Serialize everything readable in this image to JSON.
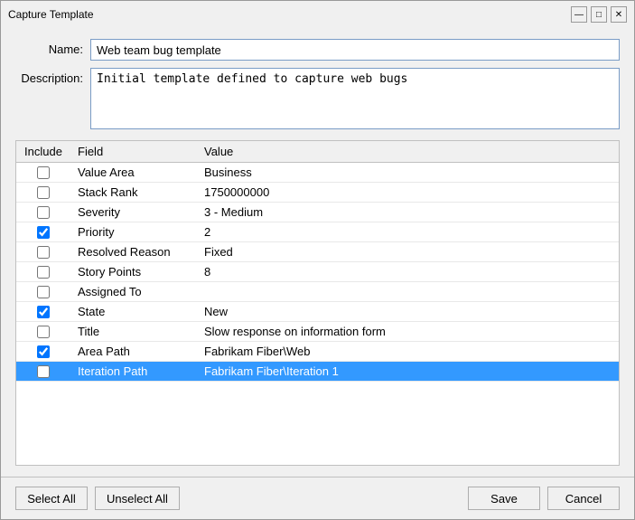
{
  "window": {
    "title": "Capture Template"
  },
  "titlebar": {
    "minimize_label": "—",
    "maximize_label": "□",
    "close_label": "✕"
  },
  "form": {
    "name_label": "Name:",
    "name_value": "Web team bug template",
    "description_label": "Description:",
    "description_value": "Initial template defined to capture web bugs"
  },
  "table": {
    "headers": [
      "Include",
      "Field",
      "Value"
    ],
    "rows": [
      {
        "checked": false,
        "field": "Value Area",
        "value": "Business",
        "selected": false
      },
      {
        "checked": false,
        "field": "Stack Rank",
        "value": "1750000000",
        "selected": false
      },
      {
        "checked": false,
        "field": "Severity",
        "value": "3 - Medium",
        "selected": false
      },
      {
        "checked": true,
        "field": "Priority",
        "value": "2",
        "selected": false
      },
      {
        "checked": false,
        "field": "Resolved Reason",
        "value": "Fixed",
        "selected": false
      },
      {
        "checked": false,
        "field": "Story Points",
        "value": "8",
        "selected": false
      },
      {
        "checked": false,
        "field": "Assigned To",
        "value": "",
        "selected": false
      },
      {
        "checked": true,
        "field": "State",
        "value": "New",
        "selected": false
      },
      {
        "checked": false,
        "field": "Title",
        "value": "Slow response on information form",
        "selected": false
      },
      {
        "checked": true,
        "field": "Area Path",
        "value": "Fabrikam Fiber\\Web",
        "selected": false
      },
      {
        "checked": false,
        "field": "Iteration Path",
        "value": "Fabrikam Fiber\\Iteration 1",
        "selected": true
      }
    ]
  },
  "footer": {
    "select_all_label": "Select All",
    "unselect_all_label": "Unselect All",
    "save_label": "Save",
    "cancel_label": "Cancel"
  }
}
